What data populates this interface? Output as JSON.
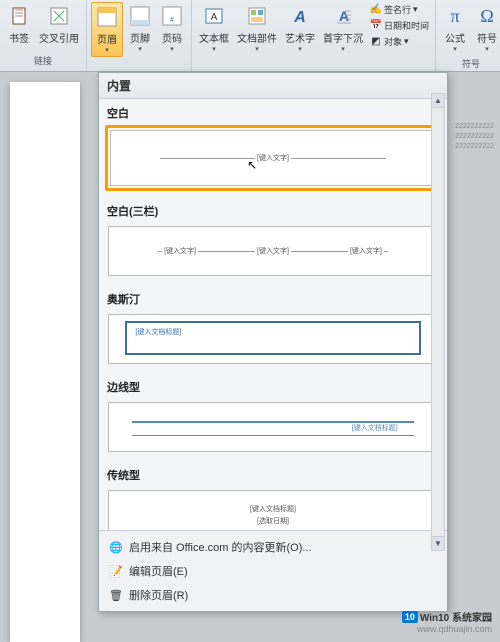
{
  "ribbon": {
    "groups": {
      "links": {
        "label": "链接",
        "buttons": {
          "bookmark": "书签",
          "crossref": "交叉引用"
        }
      },
      "headerfooter": {
        "header": "页眉",
        "footer": "页脚",
        "pagenumber": "页码"
      },
      "text": {
        "textbox": "文本框",
        "quickparts": "文档部件",
        "wordart": "艺术字",
        "dropcap": "首字下沉",
        "signature": "签名行",
        "datetime": "日期和时间",
        "object": "对象"
      },
      "symbols": {
        "label": "符号",
        "equation": "公式",
        "symbol": "符号"
      }
    }
  },
  "dropdown": {
    "title": "内置",
    "items": {
      "blank": {
        "label": "空白",
        "placeholder": "[键入文字]"
      },
      "blank3": {
        "label": "空白(三栏)",
        "placeholder": "[键入文字]"
      },
      "austin": {
        "label": "奥斯汀",
        "placeholder": "[键入文档标题]"
      },
      "bordered": {
        "label": "边线型",
        "placeholder": "[键入文档标题]"
      },
      "traditional": {
        "label": "传统型",
        "placeholder1": "[键入文档标题]",
        "placeholder2": "[选取日期]"
      }
    },
    "footer": {
      "office": "启用来自 Office.com 的内容更新(O)...",
      "edit": "编辑页眉(E)",
      "remove": "删除页眉(R)"
    }
  },
  "doc_sample": "2222222222\n2222222222\n2222222222",
  "watermark": {
    "brand_num": "10",
    "brand": "Win10 系统家园",
    "url": "www.qdhuajin.com"
  }
}
